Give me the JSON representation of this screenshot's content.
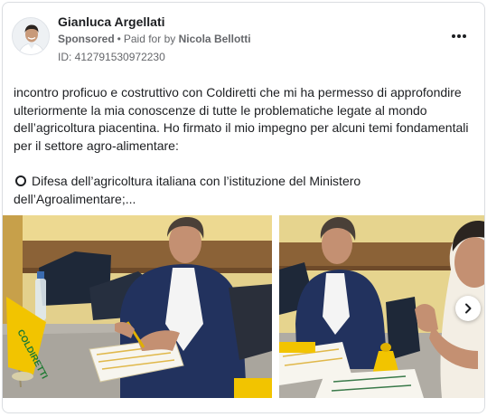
{
  "advertiser": {
    "name": "Gianluca Argellati",
    "sponsored_label": "Sponsored",
    "separator": "•",
    "paid_for_prefix": "Paid for by",
    "paid_for_name": "Nicola Bellotti",
    "ad_id": "ID: 412791530972230"
  },
  "post": {
    "text": "incontro proficuo e costruttivo con Coldiretti che mi ha permesso di approfondire ulteriormente la mia conoscenze di tutte le problematiche legate al mondo dell’agricoltura piacentina. Ho firmato il mio impegno per alcuni temi fondamentali per il settore agro-alimentare:",
    "bullet": "Difesa dell’agricoltura italiana con l’istituzione del Ministero dell’Agroalimentare;..."
  },
  "images": {
    "flag_text": "COLDIRETTI"
  },
  "icons": {
    "more": "more-options-icon",
    "bullet": "circle-bullet-icon",
    "next": "chevron-right-icon"
  },
  "colors": {
    "text": "#1c1e21",
    "secondary_text": "#65676b",
    "border": "#dadde1",
    "flag_yellow": "#f2c400"
  }
}
